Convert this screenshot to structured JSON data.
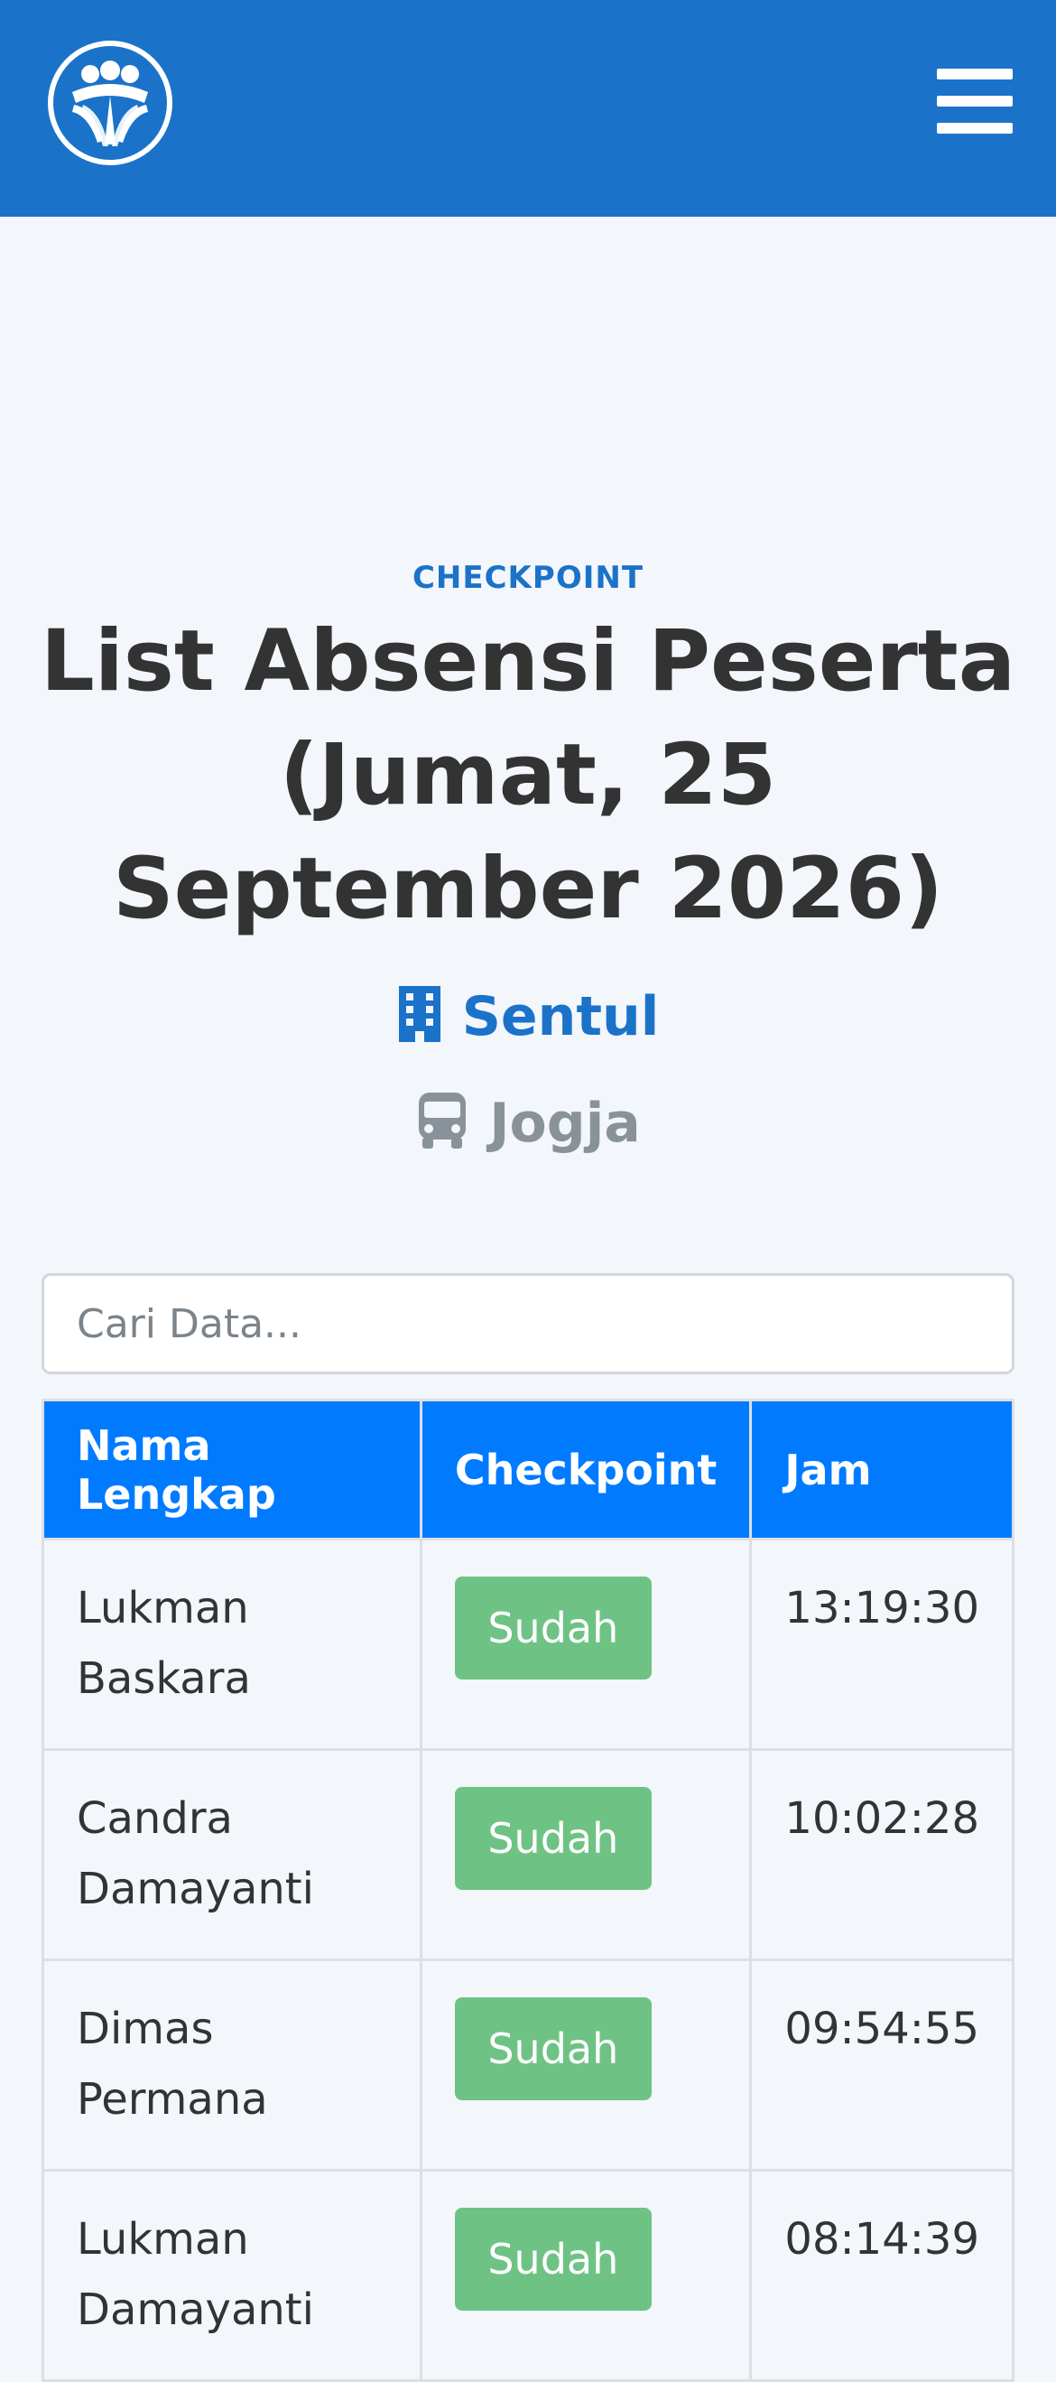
{
  "header": {
    "logo": "people-logo-icon",
    "menu_icon": "hamburger-menu-icon",
    "brand_color": "#1b72c9"
  },
  "page": {
    "section_label": "CHECKPOINT",
    "title": "List Absensi Peserta (Jumat, 25 September 2026)",
    "location": {
      "icon": "building-icon",
      "label": "Sentul",
      "color": "#1b72c9"
    },
    "transport": {
      "icon": "bus-icon",
      "label": "Jogja",
      "color": "#8a9299"
    }
  },
  "search": {
    "placeholder": "Cari Data...",
    "value": ""
  },
  "table": {
    "header_color": "#007bff",
    "columns": [
      "Nama Lengkap",
      "Checkpoint",
      "Jam"
    ],
    "rows": [
      {
        "name": "Lukman Baskara",
        "status": "Sudah",
        "time": "13:19:30"
      },
      {
        "name": "Candra Damayanti",
        "status": "Sudah",
        "time": "10:02:28"
      },
      {
        "name": "Dimas Permana",
        "status": "Sudah",
        "time": "09:54:55"
      },
      {
        "name": "Lukman Damayanti",
        "status": "Sudah",
        "time": "08:14:39"
      }
    ],
    "status_color": "#6ec384"
  }
}
